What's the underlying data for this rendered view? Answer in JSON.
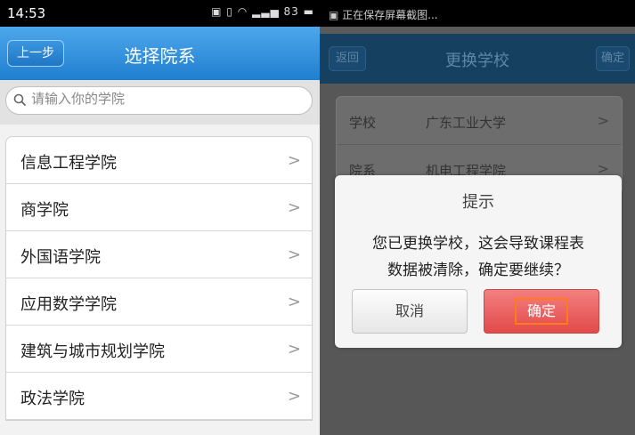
{
  "left": {
    "status": {
      "time": "14:53",
      "battery": "83"
    },
    "navbar": {
      "back_label": "上一步",
      "title": "选择院系"
    },
    "search": {
      "placeholder": "请输入你的学院"
    },
    "items": [
      {
        "label": "信息工程学院"
      },
      {
        "label": "商学院"
      },
      {
        "label": "外国语学院"
      },
      {
        "label": "应用数学学院"
      },
      {
        "label": "建筑与城市规划学院"
      },
      {
        "label": "政法学院"
      }
    ]
  },
  "right": {
    "status": {
      "notification": "正在保存屏幕截图..."
    },
    "navbar": {
      "back_label": "返回",
      "title": "更换学校",
      "ok_label": "确定"
    },
    "rows": [
      {
        "key": "学校",
        "value": "广东工业大学"
      },
      {
        "key": "院系",
        "value": "机电工程学院"
      }
    ],
    "dialog": {
      "title": "提示",
      "message_line1": "您已更换学校，这会导致课程表",
      "message_line2": "数据被清除，确定要继续？",
      "cancel_label": "取消",
      "ok_label": "确定"
    }
  },
  "colors": {
    "accent": "#2c8ae0",
    "confirm": "#e24a4a",
    "highlight": "#ff7a1a"
  },
  "icons": {
    "chevron": "chevron-right-icon",
    "search": "search-icon"
  }
}
